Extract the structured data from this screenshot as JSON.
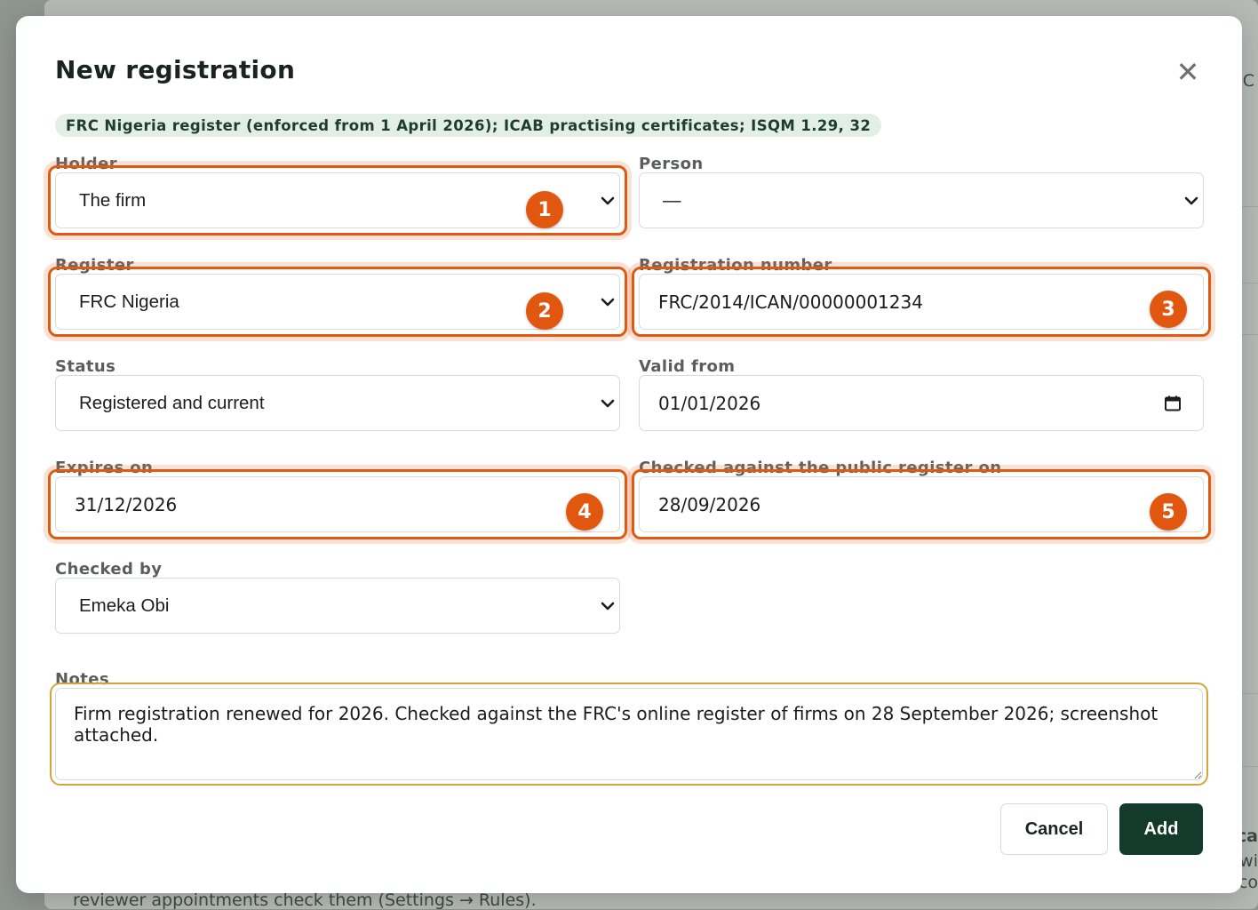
{
  "background": {
    "top_right_fragment": "C",
    "mid_right_fragment_1": "ca",
    "mid_right_fragment_2": "wi",
    "mid_right_fragment_3": "co",
    "footer_text": "reviewer appointments check them (Settings → Rules)."
  },
  "modal": {
    "title": "New registration",
    "close_label": "✕",
    "reference_badge": "FRC Nigeria register (enforced from 1 April 2026); ICAB practising certificates; ISQM 1.29, 32"
  },
  "form": {
    "holder": {
      "label": "Holder",
      "value": "The firm"
    },
    "person": {
      "label": "Person",
      "value": "—"
    },
    "register": {
      "label": "Register",
      "value": "FRC Nigeria"
    },
    "registration_number": {
      "label": "Registration number",
      "value": "FRC/2014/ICAN/00000001234"
    },
    "status": {
      "label": "Status",
      "value": "Registered and current"
    },
    "valid_from": {
      "label": "Valid from",
      "value": "01/01/2026"
    },
    "expires_on": {
      "label": "Expires on",
      "value": "31/12/2026"
    },
    "checked_on": {
      "label": "Checked against the public register on",
      "value": "28/09/2026"
    },
    "checked_by": {
      "label": "Checked by",
      "value": "Emeka Obi"
    },
    "notes": {
      "label": "Notes",
      "value": "Firm registration renewed for 2026. Checked against the FRC's online register of firms on 28 September 2026; screenshot attached."
    }
  },
  "annotations": {
    "marker_1": "1",
    "marker_2": "2",
    "marker_3": "3",
    "marker_4": "4",
    "marker_5": "5",
    "highlight_color": "#de5a10",
    "notes_highlight_color": "#d4a53a"
  },
  "buttons": {
    "cancel": "Cancel",
    "add": "Add"
  },
  "colors": {
    "primary": "#143a2c",
    "badge_bg": "#e3efe6",
    "badge_text": "#1f3d2e",
    "marker": "#e2570f"
  }
}
